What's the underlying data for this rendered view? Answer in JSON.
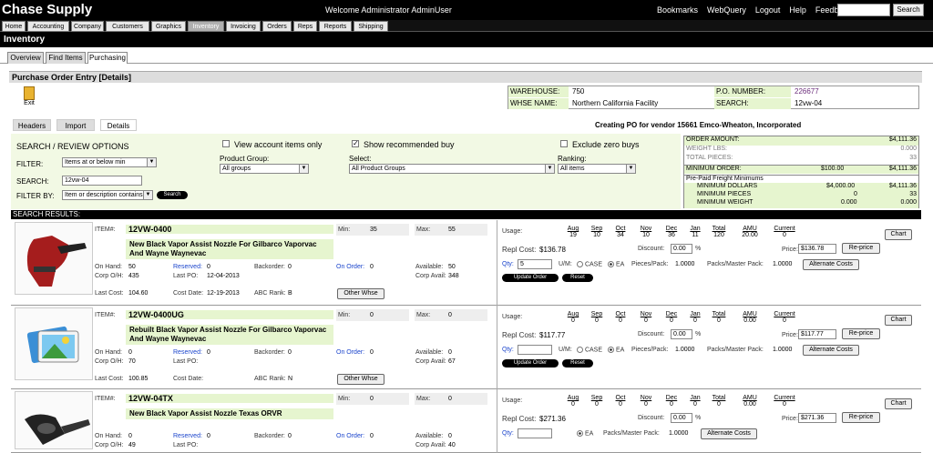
{
  "app": {
    "title": "Chase Supply",
    "welcome": "Welcome  Administrator AdminUser"
  },
  "toplinks": [
    "Bookmarks",
    "WebQuery",
    "Logout",
    "Help",
    "Feedback"
  ],
  "search_button": "Search",
  "nav": [
    "Home",
    "Accounting",
    "Company",
    "Customers",
    "Graphics",
    "Inventory",
    "Invoicing",
    "Orders",
    "Reps",
    "Reports",
    "Shipping"
  ],
  "section_title": "Inventory",
  "subtabs": [
    "Overview",
    "Find Items",
    "Purchasing"
  ],
  "po_header": "Purchase Order Entry [Details]",
  "exit_label": "Exit",
  "info": {
    "warehouse_label": "WAREHOUSE:",
    "warehouse": "750",
    "po_label": "P.O. NUMBER:",
    "po": "226677",
    "whse_name_label": "WHSE NAME:",
    "whse_name": "Northern California Facility",
    "search_label": "SEARCH:",
    "search": "12vw-04"
  },
  "creating": "Creating PO for vendor 15661 Emco-Wheaton, Incorporated",
  "buttons": {
    "headers": "Headers",
    "import": "Import",
    "details": "Details"
  },
  "options": {
    "title": "SEARCH / REVIEW OPTIONS",
    "view_account": "View account items only",
    "show_recommended": "Show recommended buy",
    "exclude_zero": "Exclude zero buys",
    "filter_label": "FILTER:",
    "filter_value": "Items at or below min",
    "product_group_label": "Product Group:",
    "product_group_value": "All groups",
    "select_label": "Select:",
    "select_value": "All Product Groups",
    "ranking_label": "Ranking:",
    "ranking_value": "All items",
    "search_label": "SEARCH:",
    "search_value": "12vw-04",
    "filterby_label": "FILTER BY:",
    "filterby_value": "Item or description contains",
    "search_btn": "Search"
  },
  "summary": {
    "order_amount_label": "ORDER AMOUNT:",
    "order_amount": "$4,111.36",
    "weight_label": "WEIGHT LBS:",
    "weight": "0.000",
    "pieces_label": "TOTAL PIECES:",
    "pieces": "33",
    "min_order_label": "MINIMUM ORDER:",
    "min_order": "$100.00",
    "min_order_total": "$4,111.36",
    "prepaid_label": "Pre-Paid Freight Minimums",
    "min_dollars_label": "MINIMUM DOLLARS",
    "min_dollars": "$4,000.00",
    "min_dollars_total": "$4,111.36",
    "min_pieces_label": "MINIMUM PIECES",
    "min_pieces": "0",
    "min_pieces_total": "33",
    "min_weight_label": "MINIMUM WEIGHT",
    "min_weight": "0.000",
    "min_weight_total": "0.000"
  },
  "results_label": "SEARCH RESULTS:",
  "usage_months": [
    "Aug",
    "Sep",
    "Oct",
    "Nov",
    "Dec",
    "Jan",
    "Total",
    "AMU",
    "Current"
  ],
  "labels": {
    "item": "ITEM#:",
    "min": "Min:",
    "max": "Max:",
    "on_hand": "On Hand:",
    "reserved": "Reserved:",
    "backorder": "Backorder:",
    "on_order": "On Order:",
    "available": "Available:",
    "corp_oh": "Corp O/H:",
    "last_po": "Last PO:",
    "corp_avail": "Corp Avail:",
    "last_cost": "Last Cost:",
    "cost_date": "Cost Date:",
    "abc_rank": "ABC Rank:",
    "other_whse": "Other Whse",
    "usage": "Usage:",
    "chart": "Chart",
    "repl_cost": "Repl Cost:",
    "discount": "Discount:",
    "price": "Price:",
    "reprice": "Re-price",
    "qty": "Qty:",
    "um": "U/M:",
    "case": "CASE",
    "ea": "EA",
    "pieces_pack": "Pieces/Pack:",
    "packs_master": "Packs/Master Pack:",
    "alt_costs": "Alternate Costs",
    "update_order": "Update Order",
    "reset": "Reset",
    "pct": "%"
  },
  "items": [
    {
      "item": "12VW-0400",
      "desc": "New Black Vapor Assist Nozzle For Gilbarco Vaporvac And Wayne Waynevac",
      "min": "35",
      "max": "55",
      "on_hand": "50",
      "reserved": "0",
      "backorder": "0",
      "on_order": "0",
      "available": "50",
      "corp_oh": "435",
      "last_po": "12-04-2013",
      "corp_avail": "348",
      "last_cost": "104.60",
      "cost_date": "12-19-2013",
      "abc": "B",
      "usage": [
        "19",
        "10",
        "34",
        "10",
        "36",
        "11",
        "120",
        "20.00",
        "0"
      ],
      "repl": "$136.78",
      "discount": "0.00",
      "price": "$136.78",
      "qty": "5",
      "pieces_pack": "1.0000",
      "packs_master": "1.0000"
    },
    {
      "item": "12VW-0400UG",
      "desc": "Rebuilt Black Vapor Assist Nozzle For Gilbarco Vaporvac And Wayne Waynevac",
      "min": "0",
      "max": "0",
      "on_hand": "0",
      "reserved": "0",
      "backorder": "0",
      "on_order": "0",
      "available": "0",
      "corp_oh": "70",
      "last_po": "",
      "corp_avail": "67",
      "last_cost": "100.85",
      "cost_date": "",
      "abc": "N",
      "usage": [
        "0",
        "0",
        "0",
        "0",
        "0",
        "0",
        "0",
        "0.00",
        "0"
      ],
      "repl": "$117.77",
      "discount": "0.00",
      "price": "$117.77",
      "qty": "",
      "pieces_pack": "1.0000",
      "packs_master": "1.0000"
    },
    {
      "item": "12VW-04TX",
      "desc": "New Black Vapor Assist Nozzle Texas ORVR",
      "min": "0",
      "max": "0",
      "on_hand": "0",
      "reserved": "0",
      "backorder": "0",
      "on_order": "0",
      "available": "0",
      "corp_oh": "49",
      "last_po": "",
      "corp_avail": "40",
      "usage": [
        "0",
        "0",
        "0",
        "0",
        "0",
        "0",
        "0",
        "0.00",
        "0"
      ],
      "repl": "$271.36",
      "discount": "0.00",
      "price": "$271.36",
      "qty": "",
      "packs_master": "1.0000"
    }
  ]
}
